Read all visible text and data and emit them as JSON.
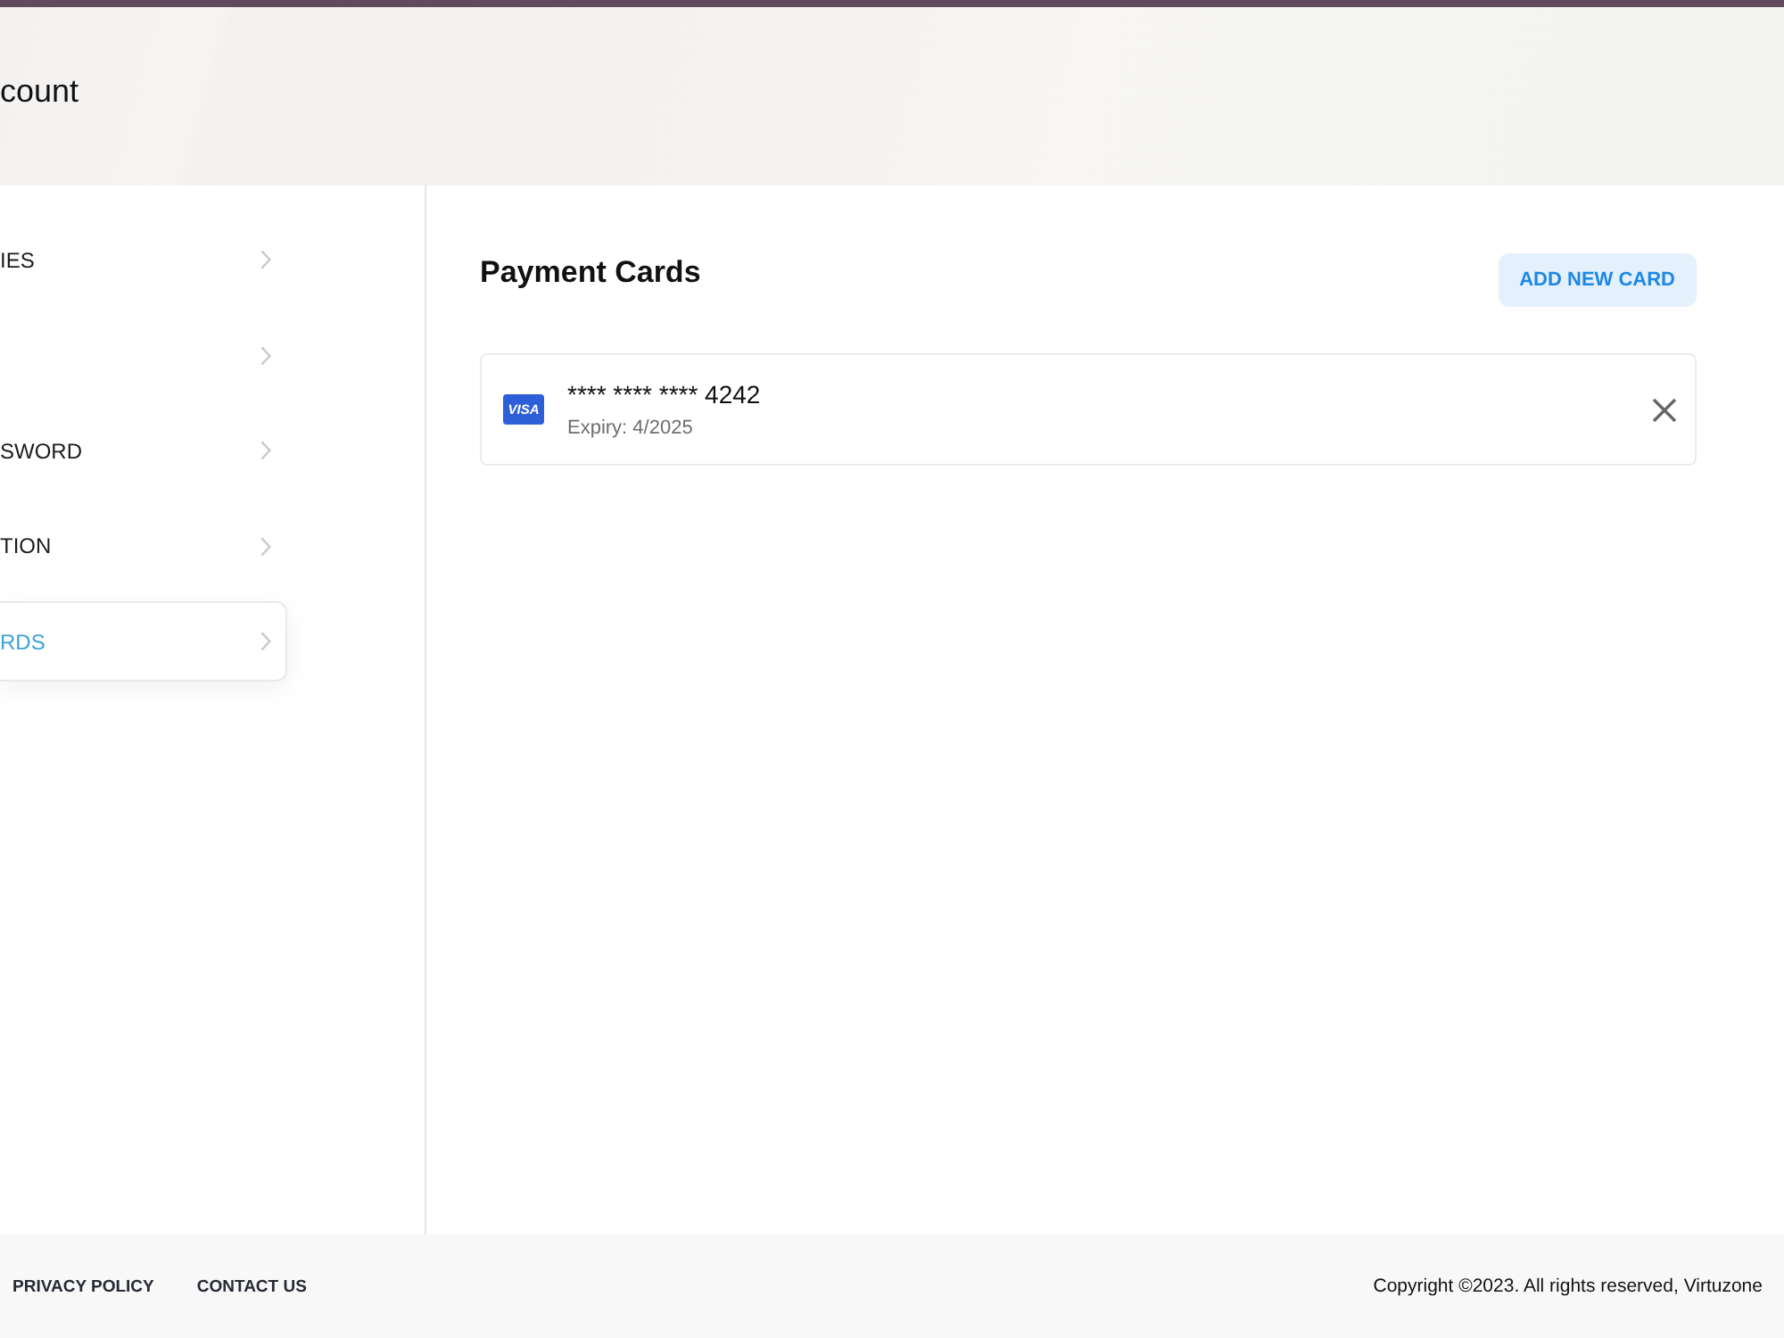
{
  "header": {
    "title": "count"
  },
  "sidebar": {
    "items": [
      {
        "label": "IES",
        "selected": false
      },
      {
        "selected": false
      },
      {
        "label": "SWORD",
        "selected": false
      },
      {
        "label": "TION",
        "selected": false
      },
      {
        "label": "RDS",
        "selected": true
      }
    ]
  },
  "main": {
    "title": "Payment Cards",
    "add_button": "ADD NEW CARD",
    "cards": [
      {
        "brand": "VISA",
        "number": "**** **** **** 4242",
        "expiry": "Expiry: 4/2025"
      }
    ]
  },
  "footer": {
    "links": [
      "PRIVACY POLICY",
      "CONTACT US"
    ],
    "copyright": "Copyright ©2023. All rights reserved, Virtuzone"
  }
}
